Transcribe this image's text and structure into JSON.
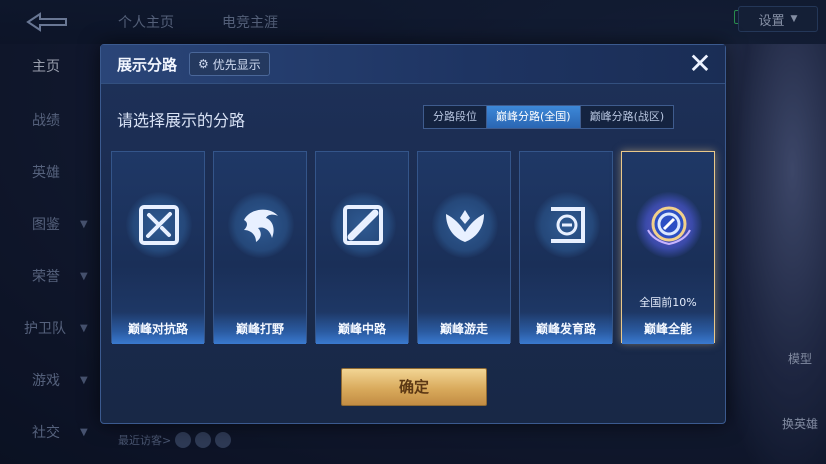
{
  "top_tabs": [
    "个人主页",
    "电竞主涯"
  ],
  "settings_label": "设置",
  "side_nav": [
    {
      "label": "主页",
      "active": true,
      "chevron": false
    },
    {
      "label": "战绩",
      "active": false,
      "chevron": false
    },
    {
      "label": "英雄",
      "active": false,
      "chevron": false
    },
    {
      "label": "图鉴",
      "active": false,
      "chevron": true
    },
    {
      "label": "荣誉",
      "active": false,
      "chevron": true
    },
    {
      "label": "护卫队",
      "active": false,
      "chevron": true
    },
    {
      "label": "游戏",
      "active": false,
      "chevron": true
    },
    {
      "label": "社交",
      "active": false,
      "chevron": true
    }
  ],
  "right_buttons": {
    "model": "模型",
    "swap_hero": "换英雄"
  },
  "recent_visitors_label": "最近访客>",
  "modal": {
    "title": "展示分路",
    "priority_label": "优先显示",
    "close_icon": "✕",
    "subtitle": "请选择展示的分路",
    "tabs": [
      {
        "label": "分路段位",
        "active": false
      },
      {
        "label": "巅峰分路(全国)",
        "active": true
      },
      {
        "label": "巅峰分路(战区)",
        "active": false
      }
    ],
    "cards": [
      {
        "label": "巅峰对抗路",
        "icon": "sword-shield-icon",
        "selected": false,
        "rank": ""
      },
      {
        "label": "巅峰打野",
        "icon": "dragon-icon",
        "selected": false,
        "rank": ""
      },
      {
        "label": "巅峰中路",
        "icon": "staff-icon",
        "selected": false,
        "rank": ""
      },
      {
        "label": "巅峰游走",
        "icon": "wings-icon",
        "selected": false,
        "rank": ""
      },
      {
        "label": "巅峰发育路",
        "icon": "bow-icon",
        "selected": false,
        "rank": ""
      },
      {
        "label": "巅峰全能",
        "icon": "all-round-badge-icon",
        "selected": true,
        "rank": "全国前10%"
      }
    ],
    "confirm_label": "确定"
  },
  "colors": {
    "accent_tab": "#2a66b3",
    "confirm_gold": "#d9aa5c",
    "selected_border": "#e9c88a"
  }
}
